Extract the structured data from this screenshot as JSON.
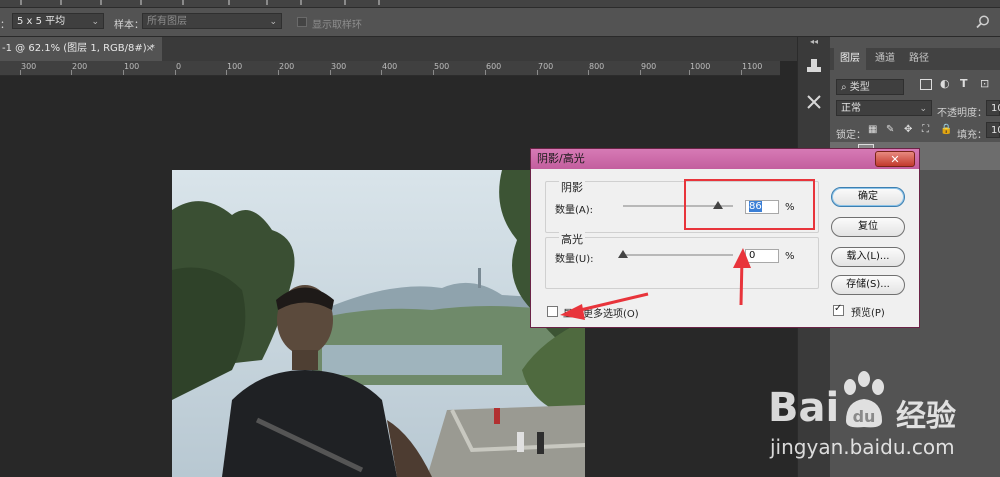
{
  "options_bar": {
    "sample_size_prefix": "：",
    "sample_size_value": "5 x 5 平均",
    "sample_label": "样本：",
    "sample_value": "所有图层",
    "show_ring_label": "显示取样环"
  },
  "document_tab": {
    "title": "-1 @ 62.1% (图层 1, RGB/8#) *",
    "close": "×"
  },
  "ruler": {
    "labels": [
      "300",
      "200",
      "100",
      "0",
      "100",
      "200",
      "300",
      "400",
      "500",
      "600",
      "700",
      "800",
      "900",
      "1000",
      "1100"
    ]
  },
  "layers_panel": {
    "tabs": [
      "图层",
      "通道",
      "路径"
    ],
    "filter_kind": "类型",
    "blend_mode": "正常",
    "opacity_label": "不透明度：",
    "opacity_value": "10",
    "lock_label": "锁定：",
    "fill_label": "填充：",
    "fill_value": "10"
  },
  "dialog": {
    "title": "阴影/高光",
    "close_glyph": "✕",
    "shadows": {
      "heading": "阴影",
      "amount_label": "数量(A):",
      "amount_value": "86",
      "amount": 86,
      "unit": "%"
    },
    "highlights": {
      "heading": "高光",
      "amount_label": "数量(U):",
      "amount_value": "0",
      "amount": 0,
      "unit": "%"
    },
    "buttons": {
      "ok": "确定",
      "reset": "复位",
      "load": "载入(L)...",
      "save": "存储(S)..."
    },
    "show_more_label": "显示更多选项(O)",
    "show_more_checked": false,
    "preview_label": "预览(P)",
    "preview_checked": true
  },
  "watermark": {
    "brand_left": "Bai",
    "brand_right": "经验",
    "url": "jingyan.baidu.com"
  },
  "colors": {
    "dialog_title": "#c35e9e",
    "annotation_red": "#e8343b",
    "selection_blue": "#3b7fd6"
  }
}
